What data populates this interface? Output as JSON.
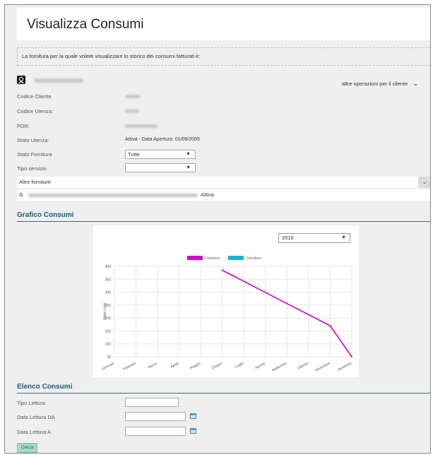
{
  "page": {
    "title": "Visualizza Consumi",
    "notice": "La fornitura per la quale volete visualizzare lo storico dei consumi fatturati è:"
  },
  "client": {
    "other_ops": "altre operazioni per il cliente"
  },
  "fields": {
    "codice_cliente_label": "Codice Cliente",
    "codice_utenza_label": "Codice Utenza:",
    "pdr_label": "PDR:",
    "stato_utenza_label": "Stato Utenza:",
    "stato_utenza_value": "Attiva - Data Apertura: 01/09/2005",
    "stato_fornitura_label": "Stato Fornitura",
    "stato_fornitura_value": "Tutte",
    "tipo_servizio_label": "Tipo servizio",
    "tipo_servizio_value": ""
  },
  "altre_forniture": {
    "label": "Altre forniture",
    "item_prefix": "G",
    "item_status": "Attiva"
  },
  "grafico": {
    "section_title": "Grafico Consumi",
    "year": "2016"
  },
  "chart_data": {
    "type": "line",
    "ylabel": "Metri cubi",
    "ylim": [
      50,
      400
    ],
    "yticks": [
      50,
      100,
      150,
      200,
      250,
      300,
      350,
      400
    ],
    "categories": [
      "Gennaio",
      "Febbraio",
      "Marzo",
      "Aprile",
      "Maggio",
      "Giugno",
      "Luglio",
      "Agosto",
      "Settembre",
      "Ottobre",
      "Novembre",
      "Dicembre"
    ],
    "grid": true,
    "legend_position": "top",
    "series": [
      {
        "name": "Contatore",
        "color": "#d400d4",
        "values": [
          null,
          null,
          null,
          null,
          null,
          385,
          null,
          null,
          null,
          null,
          170,
          50
        ]
      },
      {
        "name": "Correttore",
        "color": "#12b7c9",
        "values": []
      }
    ]
  },
  "elenco": {
    "section_title": "Elenco Consumi",
    "tipo_lettura_label": "Tipo Lettura",
    "data_da_label": "Data Lettura DA",
    "data_a_label": "Data Lettura A",
    "cerca_label": "Cerca"
  }
}
